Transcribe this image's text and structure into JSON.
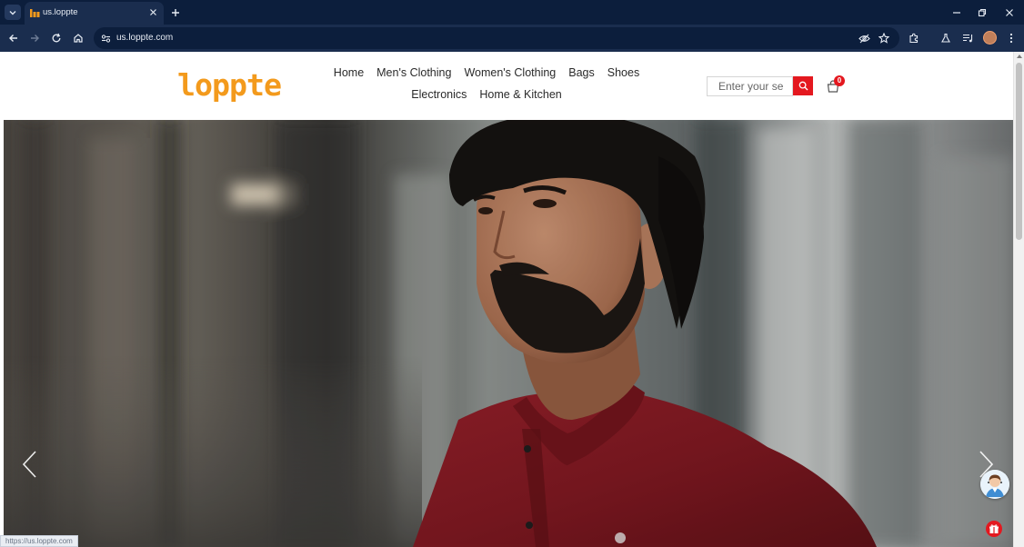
{
  "browser": {
    "tab": {
      "title": "us.loppte",
      "favicon": "loppte-favicon-icon"
    },
    "address": {
      "url": "us.loppte.com"
    },
    "status_url": "https://us.loppte.com"
  },
  "site": {
    "logo_text": "loppte",
    "brand_color": "#f39a1c",
    "accent_color": "#e4181f",
    "nav": [
      "Home",
      "Men's Clothing",
      "Women's Clothing",
      "Bags",
      "Shoes",
      "Electronics",
      "Home & Kitchen"
    ],
    "search": {
      "placeholder": "Enter your se"
    },
    "cart": {
      "count": "0"
    }
  },
  "hero": {
    "image": "man-in-red-shirt-photo",
    "prev_icon": "chevron-left-icon",
    "next_icon": "chevron-right-icon"
  },
  "widgets": {
    "chat": "support-avatar-icon",
    "gift": "gift-icon"
  }
}
